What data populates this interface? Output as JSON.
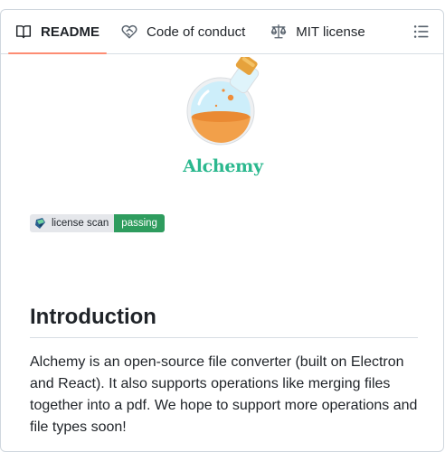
{
  "tabs": [
    {
      "label": "README",
      "icon": "book-icon",
      "active": true
    },
    {
      "label": "Code of conduct",
      "icon": "heart-handshake-icon",
      "active": false
    },
    {
      "label": "MIT license",
      "icon": "scale-icon",
      "active": false
    }
  ],
  "outline_icon": "list-unordered-icon",
  "logo": {
    "text": "Alchemy",
    "color": "#2bb88e"
  },
  "badge": {
    "left": "license scan",
    "right": "passing",
    "right_color": "#2e9c5e"
  },
  "heading": "Introduction",
  "paragraph": "Alchemy is an open-source file converter (built on Electron and React). It also supports operations like merging files together into a pdf. We hope to support more operations and file types soon!",
  "colors": {
    "active_tab_underline": "#fd8c73",
    "border": "#d0d7de"
  }
}
